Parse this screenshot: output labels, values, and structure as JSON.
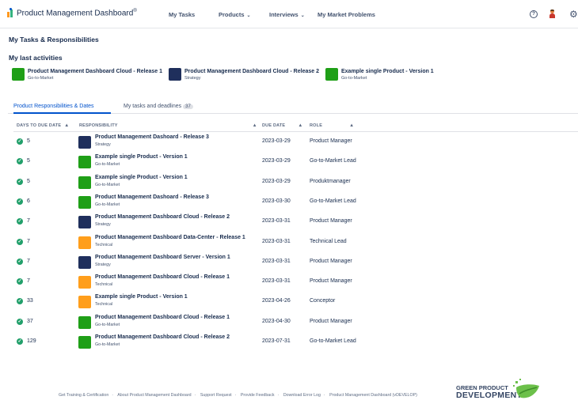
{
  "header": {
    "logo_text": "Product Management Dashboard",
    "logo_mark": "®",
    "nav": [
      {
        "label": "My Tasks",
        "chevron": ""
      },
      {
        "label": "Products",
        "chevron": "⌄"
      },
      {
        "label": "Interviews",
        "chevron": "⌄"
      },
      {
        "label": "My Market Problems",
        "chevron": ""
      }
    ],
    "help_glyph": "?",
    "gear_glyph": "⚙"
  },
  "page_title": "My Tasks & Responsibilities",
  "last_activities": {
    "heading": "My last activities",
    "items": [
      {
        "title": "Product Management Dashboard Cloud - Release 1",
        "subtitle": "Go-to-Market",
        "color": "#1f9f17"
      },
      {
        "title": "Product Management Dashboard Cloud - Release 2",
        "subtitle": "Strategy",
        "color": "#1f2f5c"
      },
      {
        "title": "Example single Product - Version 1",
        "subtitle": "Go-to-Market",
        "color": "#1f9f17"
      }
    ]
  },
  "tabs": [
    {
      "label": "Product Responsibilities & Dates",
      "active": true
    },
    {
      "label": "My tasks and deadlines",
      "badge": "37",
      "active": false
    }
  ],
  "table": {
    "columns": [
      "DAYS TO DUE DATE",
      "RESPONSIBILITY",
      "DUE DATE",
      "ROLE"
    ],
    "sort_glyphs": [
      "▲",
      "▲",
      "▲",
      "▲"
    ],
    "check_glyph": "✓",
    "rows": [
      {
        "days": "5",
        "title": "Product Management Dashoard - Release 3",
        "subtitle": "Strategy",
        "color": "#1f2f5c",
        "due": "2023-03-29",
        "role": "Product Manager"
      },
      {
        "days": "5",
        "title": "Example single Product - Version 1",
        "subtitle": "Go-to-Market",
        "color": "#1f9f17",
        "due": "2023-03-29",
        "role": "Go-to-Market Lead"
      },
      {
        "days": "5",
        "title": "Example single Product - Version 1",
        "subtitle": "Go-to-Market",
        "color": "#1f9f17",
        "due": "2023-03-29",
        "role": "Produktmanager"
      },
      {
        "days": "6",
        "title": "Product Management Dashoard - Release 3",
        "subtitle": "Go-to-Market",
        "color": "#1f9f17",
        "due": "2023-03-30",
        "role": "Go-to-Market Lead"
      },
      {
        "days": "7",
        "title": "Product Management Dashboard Cloud - Release 2",
        "subtitle": "Strategy",
        "color": "#1f2f5c",
        "due": "2023-03-31",
        "role": "Product Manager"
      },
      {
        "days": "7",
        "title": "Product Management Dashboard Data-Center - Release 1",
        "subtitle": "Technical",
        "color": "#ff9e1b",
        "due": "2023-03-31",
        "role": "Technical Lead"
      },
      {
        "days": "7",
        "title": "Product Management Dashboard Server - Version 1",
        "subtitle": "Strategy",
        "color": "#1f2f5c",
        "due": "2023-03-31",
        "role": "Product Manager"
      },
      {
        "days": "7",
        "title": "Product Management Dashboard Cloud - Release 1",
        "subtitle": "Technical",
        "color": "#ff9e1b",
        "due": "2023-03-31",
        "role": "Product Manager"
      },
      {
        "days": "33",
        "title": "Example single Product - Version 1",
        "subtitle": "Technical",
        "color": "#ff9e1b",
        "due": "2023-04-26",
        "role": "Conceptor"
      },
      {
        "days": "37",
        "title": "Product Management Dashboard Cloud - Release 1",
        "subtitle": "Go-to-Market",
        "color": "#1f9f17",
        "due": "2023-04-30",
        "role": "Product Manager"
      },
      {
        "days": "129",
        "title": "Product Management Dashboard Cloud - Release 2",
        "subtitle": "Go-to-Market",
        "color": "#1f9f17",
        "due": "2023-07-31",
        "role": "Go-to-Market Lead"
      }
    ]
  },
  "footer": {
    "links": [
      "Get Training & Certification",
      "About Product Management Dashboard",
      "Support Request",
      "Provide Feedback",
      "Download Error Log",
      "Product Management Dashboard (vDEVELOP)"
    ],
    "separator": "·",
    "brand_line1_a": "GREEN ",
    "brand_line1_b": "PRODUCT",
    "brand_line2": "DEVELOPMENT",
    "brand_mark": "™"
  }
}
